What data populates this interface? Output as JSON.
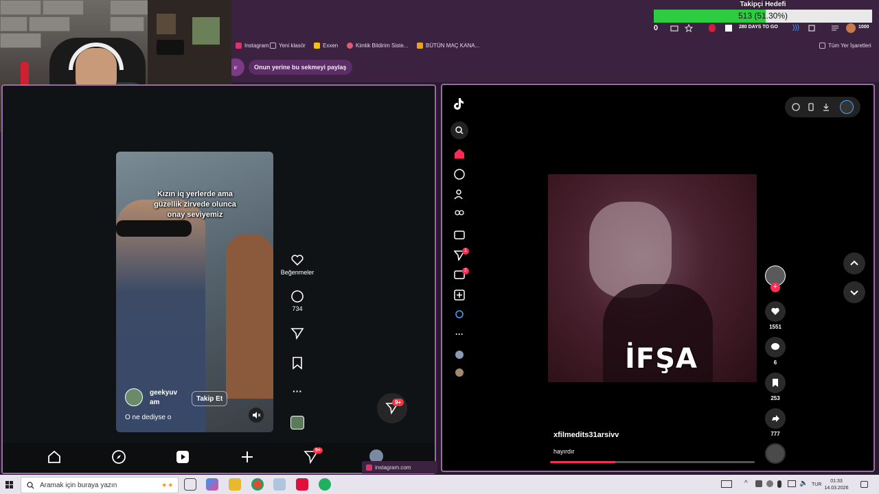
{
  "goal": {
    "title": "Takipçi Hedefi",
    "progress_text": "513 (51.30%)",
    "fraction": 0.513
  },
  "toolbar": {
    "counter": "0",
    "days_to_go": "280 DAYS TO GO",
    "right_count": "1000"
  },
  "bookmarks": [
    {
      "label": "Instagram",
      "color": "#e1306c"
    },
    {
      "label": "Yeni klasör",
      "color": "#c8b8cc"
    },
    {
      "label": "Exxen",
      "color": "#f5c400"
    },
    {
      "label": "Kimlik Bildirim Siste...",
      "color": "#e05a7a"
    },
    {
      "label": "BÜTÜN MAÇ KANA...",
      "color": "#f0a020"
    }
  ],
  "bookmarks_right": "Tüm Yer İşaretleri",
  "share_chip": "Onun yerine bu sekmeyi paylaş",
  "share_left": "ır",
  "instagram": {
    "caption_lines": [
      "Kızın iq yerlerde ama",
      "güzellik zirvede olunca",
      "onay seviyemiz"
    ],
    "user": "geekyuv",
    "user2": "am",
    "follow": "Takip Et",
    "reel_text": "O ne dediyse o",
    "likes_label": "Beğenmeler",
    "comments": "734",
    "messages_badge": "9+",
    "nav_badge": "9+",
    "tab_label": "instagram.com"
  },
  "tiktok": {
    "overlay": "İFŞA",
    "username": "xfilmedits31arsivv",
    "description": "hayırdır",
    "likes": "1551",
    "comments": "6",
    "saves": "253",
    "shares": "777",
    "messages_badge": "1",
    "inbox_badge": "2",
    "progress": 0.32
  },
  "taskbar": {
    "search_placeholder": "Aramak için buraya yazın",
    "lang": "TUR",
    "time": "01:33",
    "date": "14.03.2026"
  },
  "colors": {
    "accent_pink": "#fe2c55",
    "goal_green": "#2ecc40",
    "pane_border": "#9a6ba6",
    "chrome_bg": "#3b2240"
  }
}
